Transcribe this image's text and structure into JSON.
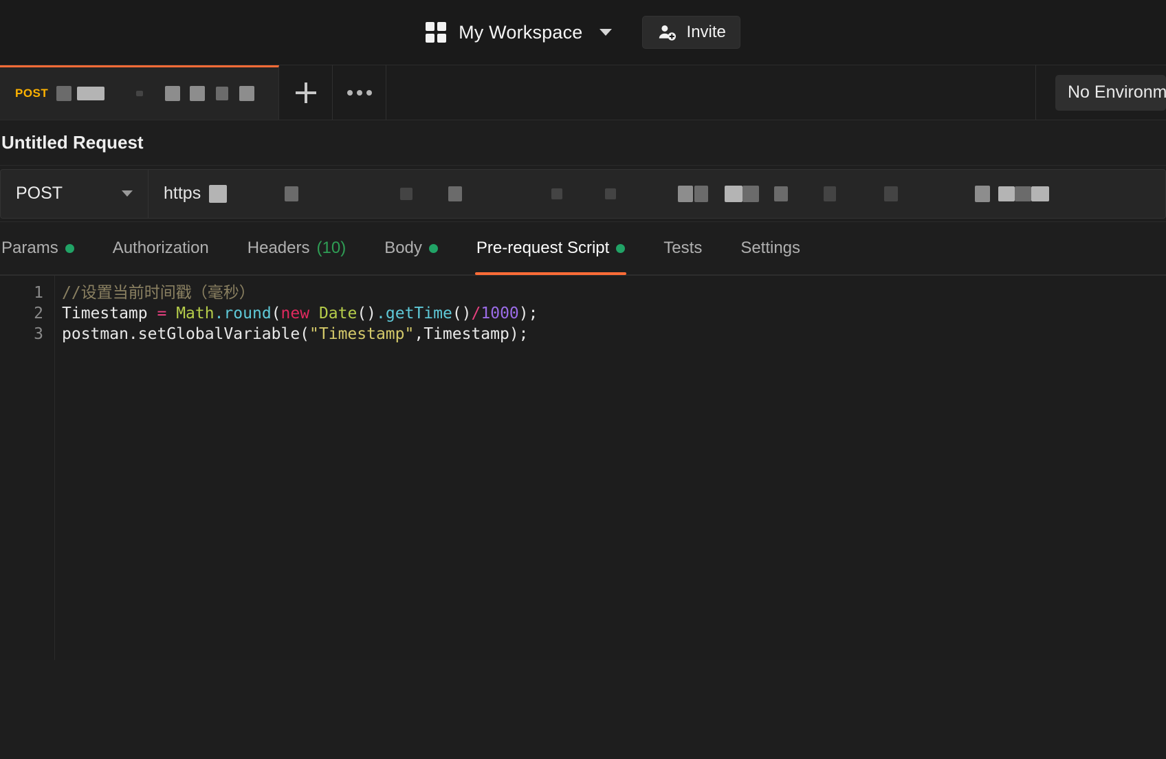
{
  "header": {
    "grid_icon": "grid-icon",
    "workspace_name": "My Workspace",
    "workspace_caret": "chevron-down-icon",
    "invite_label": "Invite",
    "invite_icon": "user-add-icon"
  },
  "tabstrip": {
    "request_tab": {
      "method": "POST",
      "name_redacted": true
    },
    "new_tab_icon": "plus-icon",
    "more_tabs_icon": "ellipsis-icon",
    "environment_label": "No Environment"
  },
  "request": {
    "title": "Untitled Request",
    "method": "POST",
    "method_caret": "chevron-down-icon",
    "url_prefix": "https",
    "url_redacted": true
  },
  "section_tabs": [
    {
      "label": "Params",
      "dot": true,
      "count": "",
      "active": false
    },
    {
      "label": "Authorization",
      "dot": false,
      "count": "",
      "active": false
    },
    {
      "label": "Headers",
      "dot": false,
      "count": "(10)",
      "active": false
    },
    {
      "label": "Body",
      "dot": true,
      "count": "",
      "active": false
    },
    {
      "label": "Pre-request Script",
      "dot": true,
      "count": "",
      "active": true
    },
    {
      "label": "Tests",
      "dot": false,
      "count": "",
      "active": false
    },
    {
      "label": "Settings",
      "dot": false,
      "count": "",
      "active": false
    }
  ],
  "editor": {
    "line_numbers": [
      "1",
      "2",
      "3"
    ],
    "lines": [
      "//设置当前时间戳（毫秒）",
      "Timestamp = Math.round(new Date().getTime()/1000);",
      "postman.setGlobalVariable(\"Timestamp\",Timestamp);"
    ],
    "line1": {
      "comment": "//设置当前时间戳（毫秒）"
    },
    "line2": {
      "var": "Timestamp ",
      "eq": "= ",
      "cls_math": "Math",
      "dot_round": ".round",
      "paren_open": "(",
      "kw_new": "new",
      "space": " ",
      "cls_date": "Date",
      "parens1": "()",
      "dot_gettime": ".getTime",
      "parens2": "()",
      "slash": "/",
      "num": "1000",
      "tail": ");"
    },
    "line3": {
      "head": "postman.setGlobalVariable(",
      "str": "\"Timestamp\"",
      "tail": ",Timestamp);"
    }
  },
  "colors": {
    "accent": "#ff6c37",
    "method_post": "#ffb300",
    "status_dot": "#21a366",
    "count_green": "#2f9e55",
    "bg": "#1e1e1e",
    "editor_bg": "#1d1d1d"
  }
}
